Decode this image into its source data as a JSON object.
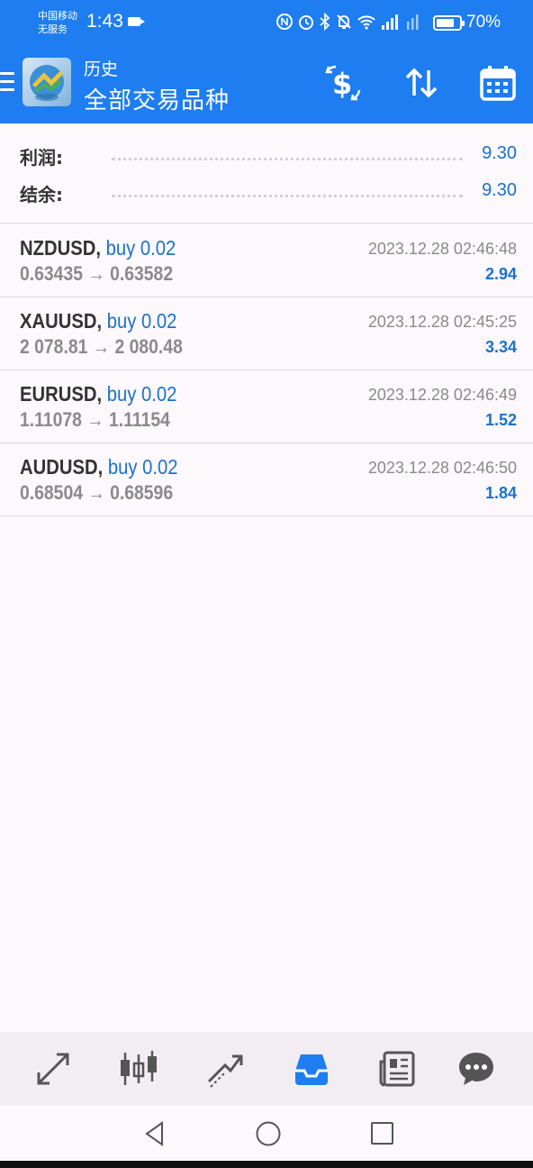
{
  "status_bar": {
    "carrier_line1": "中国移动",
    "carrier_line2": "无服务",
    "time": "1:43",
    "battery": "70%",
    "battery_fraction": 0.7
  },
  "app_bar": {
    "subtitle": "历史",
    "title": "全部交易品种",
    "icons": [
      "menu-icon",
      "app-logo",
      "deposit-dollar-icon",
      "sort-arrows-icon",
      "calendar-icon"
    ]
  },
  "summary": {
    "profit_label": "利润:",
    "profit_value": "9.30",
    "balance_label": "结余:",
    "balance_value": "9.30"
  },
  "trades": [
    {
      "symbol": "NZDUSD,",
      "direction": "buy 0.02",
      "prices": "0.63435 → 0.63582",
      "time": "2023.12.28 02:46:48",
      "profit": "2.94"
    },
    {
      "symbol": "XAUUSD,",
      "direction": "buy 0.02",
      "prices": "2 078.81 → 2 080.48",
      "time": "2023.12.28 02:45:25",
      "profit": "3.34"
    },
    {
      "symbol": "EURUSD,",
      "direction": "buy 0.02",
      "prices": "1.11078 → 1.11154",
      "time": "2023.12.28 02:46:49",
      "profit": "1.52"
    },
    {
      "symbol": "AUDUSD,",
      "direction": "buy 0.02",
      "prices": "0.68504 → 0.68596",
      "time": "2023.12.28 02:46:50",
      "profit": "1.84"
    }
  ],
  "bottom_nav": [
    "quotes-icon",
    "chart-icon",
    "trade-icon",
    "history-icon",
    "news-icon",
    "messages-icon"
  ],
  "bottom_nav_active": "history-icon",
  "colors": {
    "brand_blue": "#1e7df0",
    "value_blue": "#1a72c9",
    "muted_gray": "#8a8a8a",
    "text_dark": "#333333",
    "background": "#fcf8fc"
  }
}
